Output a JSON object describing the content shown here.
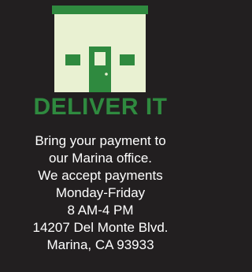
{
  "colors": {
    "background": "#221f20",
    "accent_green": "#2f8a3f",
    "building_fill": "#e9f1d2",
    "heading_color": "#2f8a3f",
    "text_color": "#ffffff"
  },
  "icon": "storefront-icon",
  "heading": "DELIVER IT",
  "body_lines": [
    "Bring your payment to",
    "our Marina office.",
    "We accept payments",
    "Monday-Friday",
    "8 AM-4 PM",
    "14207 Del Monte Blvd.",
    "Marina, CA 93933"
  ]
}
